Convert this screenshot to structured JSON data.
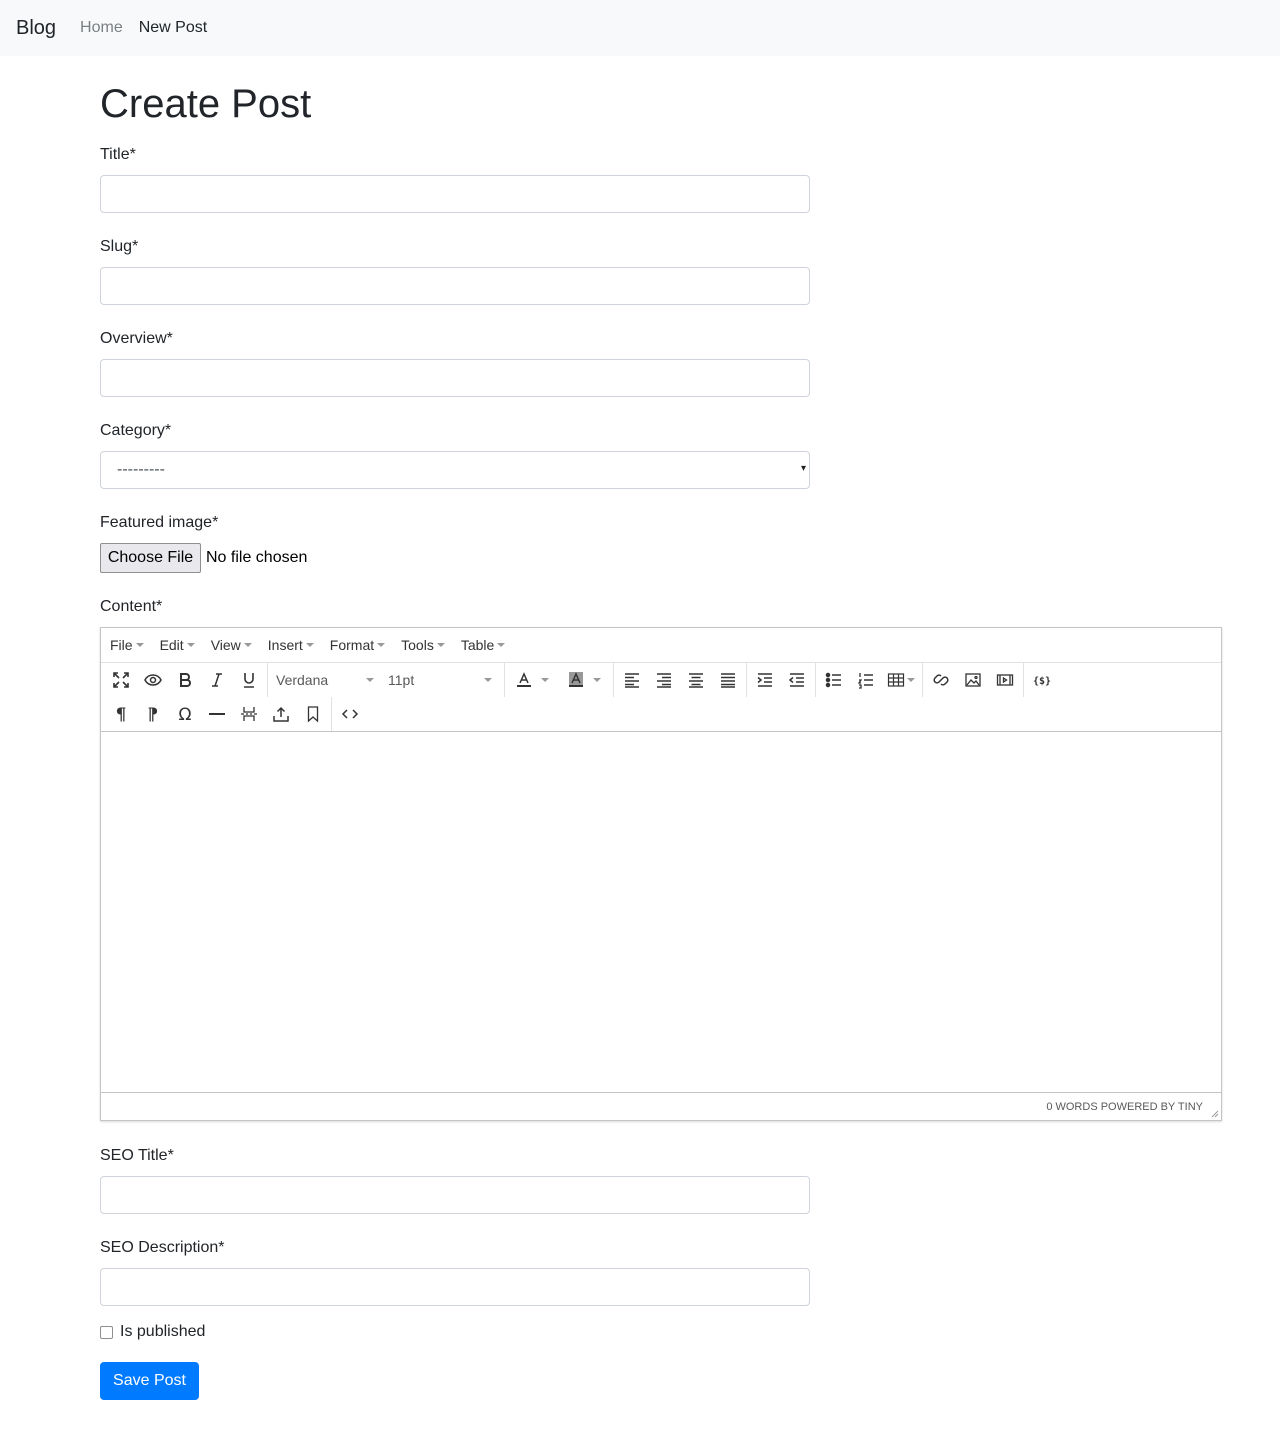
{
  "navbar": {
    "brand": "Blog",
    "links": [
      {
        "label": "Home",
        "active": false
      },
      {
        "label": "New Post",
        "active": true
      }
    ]
  },
  "page": {
    "title": "Create Post"
  },
  "form": {
    "title_label": "Title*",
    "title_value": "",
    "slug_label": "Slug*",
    "slug_value": "",
    "overview_label": "Overview*",
    "overview_value": "",
    "category_label": "Category*",
    "category_selected": "---------",
    "featured_image_label": "Featured image*",
    "file_button": "Choose File",
    "file_status": "No file chosen",
    "content_label": "Content*",
    "seo_title_label": "SEO Title*",
    "seo_title_value": "",
    "seo_description_label": "SEO Description*",
    "seo_description_value": "",
    "is_published_label": "Is published",
    "is_published": false,
    "save_button": "Save Post"
  },
  "editor": {
    "menus": [
      "File",
      "Edit",
      "View",
      "Insert",
      "Format",
      "Tools",
      "Table"
    ],
    "font_family": "Verdana",
    "font_size": "11pt",
    "status": "0 WORDS POWERED BY TINY"
  },
  "colors": {
    "primary": "#007bff",
    "navbar_bg": "#f8f9fa",
    "text": "#212529"
  }
}
